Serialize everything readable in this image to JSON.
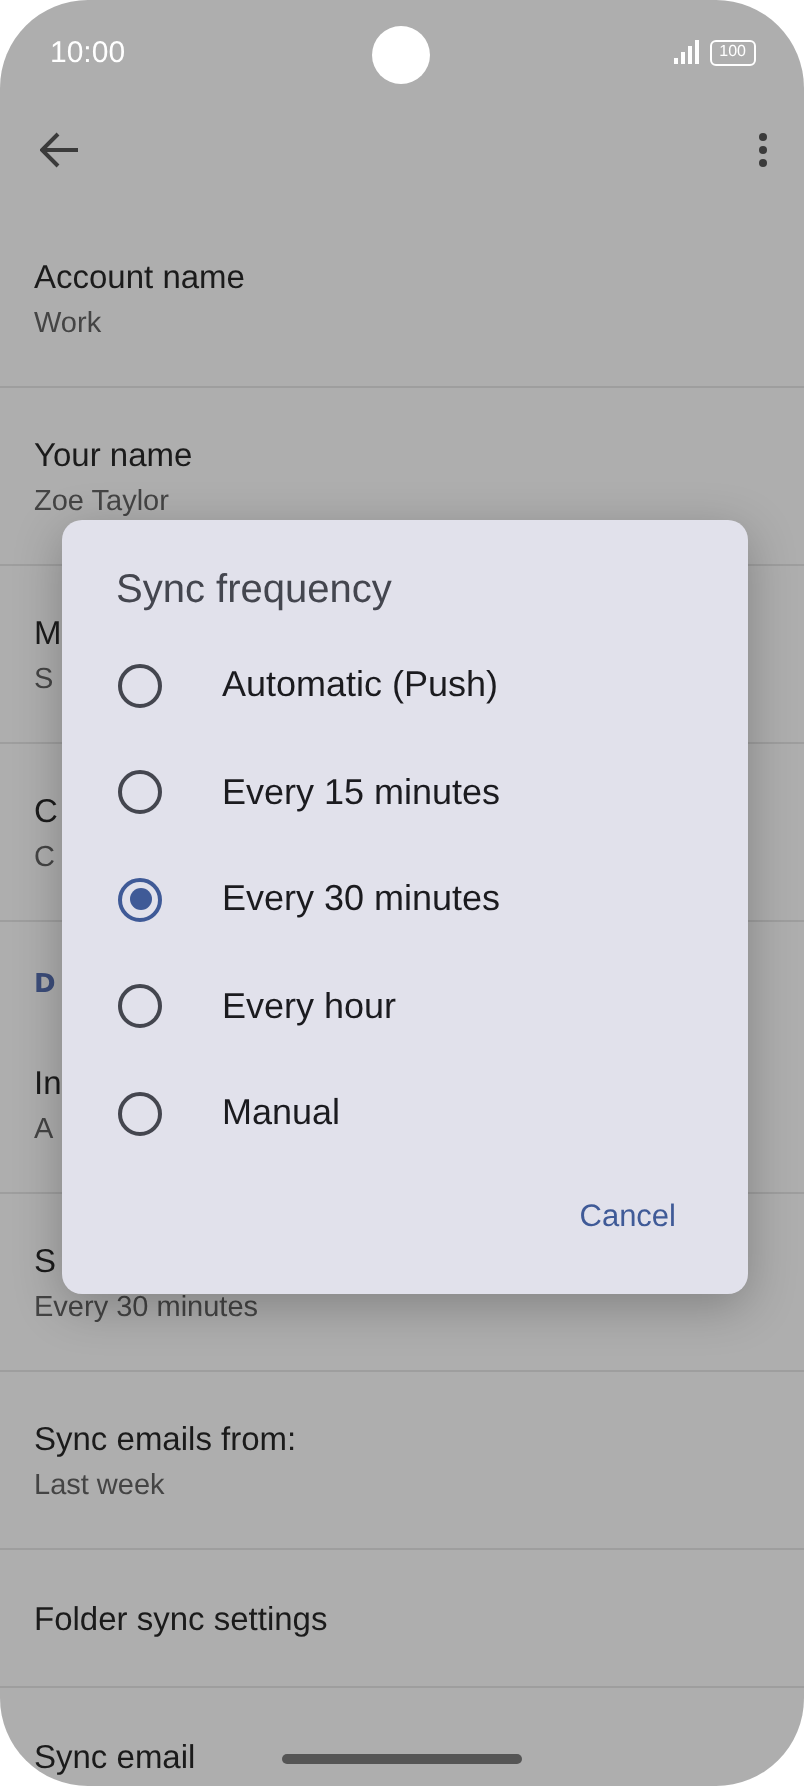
{
  "status_bar": {
    "time": "10:00",
    "battery": "100"
  },
  "settings": [
    {
      "kind": "item",
      "title": "Account name",
      "subtitle": "Work"
    },
    {
      "kind": "item",
      "title": "Your name",
      "subtitle": "Zoe Taylor"
    },
    {
      "kind": "item",
      "title": "M",
      "subtitle": "S"
    },
    {
      "kind": "item",
      "title": "C",
      "subtitle": "C"
    },
    {
      "kind": "header",
      "title": "D"
    },
    {
      "kind": "item",
      "title": "In",
      "subtitle": "A"
    },
    {
      "kind": "item",
      "title": "S",
      "subtitle": "Every 30 minutes"
    },
    {
      "kind": "item",
      "title": "Sync emails from:",
      "subtitle": "Last week"
    },
    {
      "kind": "item",
      "title": "Folder sync settings"
    },
    {
      "kind": "item",
      "title": "Sync email"
    }
  ],
  "dialog": {
    "title": "Sync frequency",
    "options": [
      {
        "label": "Automatic (Push)",
        "selected": false
      },
      {
        "label": "Every 15 minutes",
        "selected": false
      },
      {
        "label": "Every 30 minutes",
        "selected": true
      },
      {
        "label": "Every hour",
        "selected": false
      },
      {
        "label": "Manual",
        "selected": false
      }
    ],
    "button": "Cancel"
  }
}
